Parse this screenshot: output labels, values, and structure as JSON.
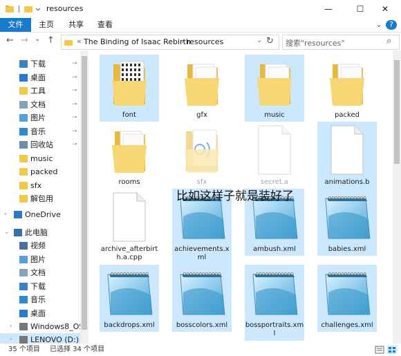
{
  "window": {
    "title": "resources",
    "minimize": "—",
    "maximize": "☐",
    "close": "✕"
  },
  "ribbon": {
    "tabs": [
      {
        "label": "文件",
        "active": true
      },
      {
        "label": "主页"
      },
      {
        "label": "共享"
      },
      {
        "label": "查看"
      }
    ],
    "expand": "⌄",
    "help": "?"
  },
  "nav": {
    "back": "←",
    "forward": "→",
    "dropdown": "⌄",
    "up": "↑",
    "address_prefix": "«",
    "breadcrumb": [
      "The Binding of Isaac Rebirth",
      "resources"
    ],
    "refresh": "↻",
    "search_placeholder": "搜索\"resources\"",
    "search_icon": "⌕"
  },
  "sidebar": {
    "quick_access": [
      {
        "label": "下载",
        "pinned": true
      },
      {
        "label": "桌面",
        "pinned": true
      },
      {
        "label": "工具",
        "pinned": true
      },
      {
        "label": "文档",
        "pinned": true
      },
      {
        "label": "图片",
        "pinned": true
      },
      {
        "label": "音乐",
        "pinned": true
      },
      {
        "label": "回收站",
        "pinned": true
      },
      {
        "label": "music"
      },
      {
        "label": "packed"
      },
      {
        "label": "sfx"
      },
      {
        "label": "解包用"
      }
    ],
    "onedrive": "OneDrive",
    "this_pc": "此电脑",
    "pc_items": [
      "视频",
      "图片",
      "文档",
      "下载",
      "音乐",
      "桌面"
    ],
    "drives": [
      "Windows8_OS",
      "LENOVO (D:)"
    ],
    "pin_glyph": "📌"
  },
  "files": [
    {
      "name": "font",
      "type": "folder-font",
      "selected": true
    },
    {
      "name": "gfx",
      "type": "folder",
      "selected": false
    },
    {
      "name": "music",
      "type": "folder",
      "selected": true
    },
    {
      "name": "packed",
      "type": "folder",
      "selected": false
    },
    {
      "name": "rooms",
      "type": "folder",
      "selected": false
    },
    {
      "name": "sfx",
      "type": "folder-sfx",
      "selected": false,
      "faded": true
    },
    {
      "name": "secret.a",
      "type": "file",
      "selected": false,
      "faded": true
    },
    {
      "name": "animations.b",
      "type": "file",
      "selected": true
    },
    {
      "name": "archive_afterbirth.a.cpp",
      "type": "file",
      "selected": false
    },
    {
      "name": "achievements.xml",
      "type": "notepad",
      "selected": true
    },
    {
      "name": "ambush.xml",
      "type": "notepad",
      "selected": true
    },
    {
      "name": "babies.xml",
      "type": "notepad",
      "selected": true
    },
    {
      "name": "backdrops.xml",
      "type": "notepad",
      "selected": true
    },
    {
      "name": "bosscolors.xml",
      "type": "notepad",
      "selected": true
    },
    {
      "name": "bossportraits.xml",
      "type": "notepad",
      "selected": true
    },
    {
      "name": "challenges.xml",
      "type": "notepad",
      "selected": true
    }
  ],
  "overlay_text": "比如这样子就是装好了",
  "status": {
    "count": "35 个项目",
    "selected": "已选择 34 个项目"
  },
  "colors": {
    "accent": "#1979ca",
    "selection": "#cce8ff",
    "folder": "#f7d774"
  }
}
